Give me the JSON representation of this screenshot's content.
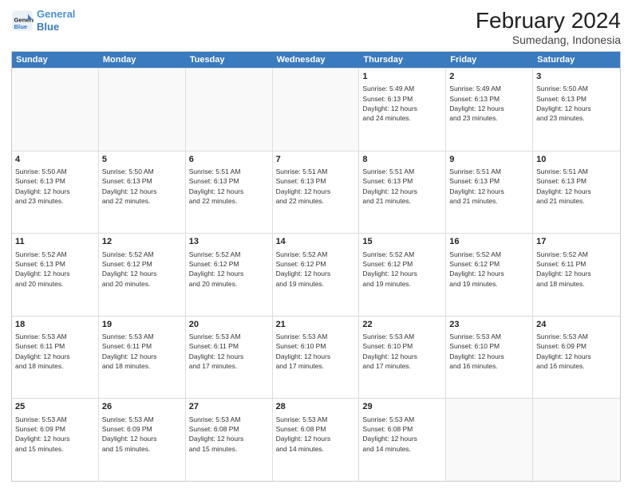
{
  "logo": {
    "line1": "General",
    "line2": "Blue"
  },
  "title": "February 2024",
  "subtitle": "Sumedang, Indonesia",
  "days": [
    "Sunday",
    "Monday",
    "Tuesday",
    "Wednesday",
    "Thursday",
    "Friday",
    "Saturday"
  ],
  "weeks": [
    [
      {
        "day": "",
        "info": ""
      },
      {
        "day": "",
        "info": ""
      },
      {
        "day": "",
        "info": ""
      },
      {
        "day": "",
        "info": ""
      },
      {
        "day": "1",
        "info": "Sunrise: 5:49 AM\nSunset: 6:13 PM\nDaylight: 12 hours\nand 24 minutes."
      },
      {
        "day": "2",
        "info": "Sunrise: 5:49 AM\nSunset: 6:13 PM\nDaylight: 12 hours\nand 23 minutes."
      },
      {
        "day": "3",
        "info": "Sunrise: 5:50 AM\nSunset: 6:13 PM\nDaylight: 12 hours\nand 23 minutes."
      }
    ],
    [
      {
        "day": "4",
        "info": "Sunrise: 5:50 AM\nSunset: 6:13 PM\nDaylight: 12 hours\nand 23 minutes."
      },
      {
        "day": "5",
        "info": "Sunrise: 5:50 AM\nSunset: 6:13 PM\nDaylight: 12 hours\nand 22 minutes."
      },
      {
        "day": "6",
        "info": "Sunrise: 5:51 AM\nSunset: 6:13 PM\nDaylight: 12 hours\nand 22 minutes."
      },
      {
        "day": "7",
        "info": "Sunrise: 5:51 AM\nSunset: 6:13 PM\nDaylight: 12 hours\nand 22 minutes."
      },
      {
        "day": "8",
        "info": "Sunrise: 5:51 AM\nSunset: 6:13 PM\nDaylight: 12 hours\nand 21 minutes."
      },
      {
        "day": "9",
        "info": "Sunrise: 5:51 AM\nSunset: 6:13 PM\nDaylight: 12 hours\nand 21 minutes."
      },
      {
        "day": "10",
        "info": "Sunrise: 5:51 AM\nSunset: 6:13 PM\nDaylight: 12 hours\nand 21 minutes."
      }
    ],
    [
      {
        "day": "11",
        "info": "Sunrise: 5:52 AM\nSunset: 6:13 PM\nDaylight: 12 hours\nand 20 minutes."
      },
      {
        "day": "12",
        "info": "Sunrise: 5:52 AM\nSunset: 6:12 PM\nDaylight: 12 hours\nand 20 minutes."
      },
      {
        "day": "13",
        "info": "Sunrise: 5:52 AM\nSunset: 6:12 PM\nDaylight: 12 hours\nand 20 minutes."
      },
      {
        "day": "14",
        "info": "Sunrise: 5:52 AM\nSunset: 6:12 PM\nDaylight: 12 hours\nand 19 minutes."
      },
      {
        "day": "15",
        "info": "Sunrise: 5:52 AM\nSunset: 6:12 PM\nDaylight: 12 hours\nand 19 minutes."
      },
      {
        "day": "16",
        "info": "Sunrise: 5:52 AM\nSunset: 6:12 PM\nDaylight: 12 hours\nand 19 minutes."
      },
      {
        "day": "17",
        "info": "Sunrise: 5:52 AM\nSunset: 6:11 PM\nDaylight: 12 hours\nand 18 minutes."
      }
    ],
    [
      {
        "day": "18",
        "info": "Sunrise: 5:53 AM\nSunset: 6:11 PM\nDaylight: 12 hours\nand 18 minutes."
      },
      {
        "day": "19",
        "info": "Sunrise: 5:53 AM\nSunset: 6:11 PM\nDaylight: 12 hours\nand 18 minutes."
      },
      {
        "day": "20",
        "info": "Sunrise: 5:53 AM\nSunset: 6:11 PM\nDaylight: 12 hours\nand 17 minutes."
      },
      {
        "day": "21",
        "info": "Sunrise: 5:53 AM\nSunset: 6:10 PM\nDaylight: 12 hours\nand 17 minutes."
      },
      {
        "day": "22",
        "info": "Sunrise: 5:53 AM\nSunset: 6:10 PM\nDaylight: 12 hours\nand 17 minutes."
      },
      {
        "day": "23",
        "info": "Sunrise: 5:53 AM\nSunset: 6:10 PM\nDaylight: 12 hours\nand 16 minutes."
      },
      {
        "day": "24",
        "info": "Sunrise: 5:53 AM\nSunset: 6:09 PM\nDaylight: 12 hours\nand 16 minutes."
      }
    ],
    [
      {
        "day": "25",
        "info": "Sunrise: 5:53 AM\nSunset: 6:09 PM\nDaylight: 12 hours\nand 15 minutes."
      },
      {
        "day": "26",
        "info": "Sunrise: 5:53 AM\nSunset: 6:09 PM\nDaylight: 12 hours\nand 15 minutes."
      },
      {
        "day": "27",
        "info": "Sunrise: 5:53 AM\nSunset: 6:08 PM\nDaylight: 12 hours\nand 15 minutes."
      },
      {
        "day": "28",
        "info": "Sunrise: 5:53 AM\nSunset: 6:08 PM\nDaylight: 12 hours\nand 14 minutes."
      },
      {
        "day": "29",
        "info": "Sunrise: 5:53 AM\nSunset: 6:08 PM\nDaylight: 12 hours\nand 14 minutes."
      },
      {
        "day": "",
        "info": ""
      },
      {
        "day": "",
        "info": ""
      }
    ]
  ]
}
